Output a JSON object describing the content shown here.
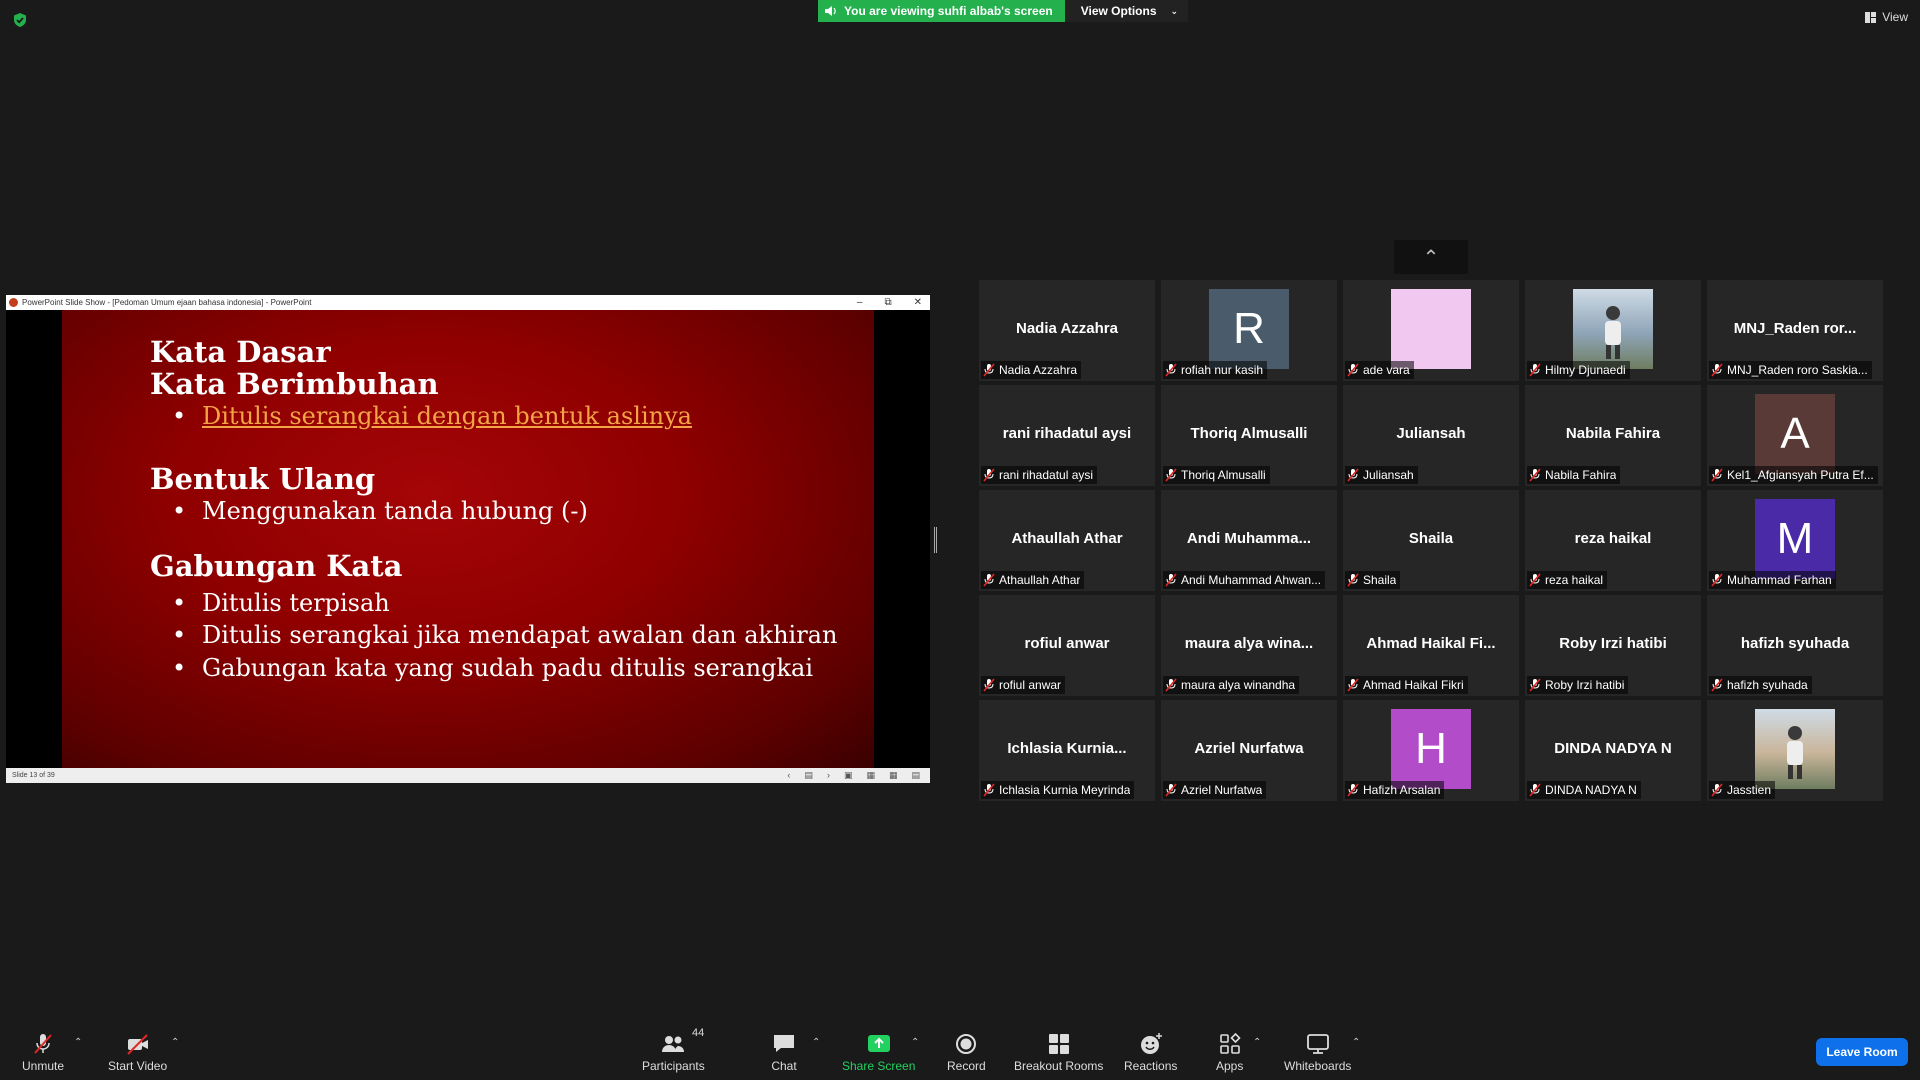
{
  "banner": {
    "text": "You are viewing suhfi albab's screen",
    "view_options": "View Options"
  },
  "view_label": "View",
  "powerpoint": {
    "title": "PowerPoint Slide Show - [Pedoman Umum ejaan bahasa indonesia] - PowerPoint",
    "status": "Slide 13 of 39",
    "slide": {
      "h1": "Kata Dasar",
      "h2": "Kata Berimbuhan",
      "b1": "Ditulis serangkai dengan bentuk aslinya",
      "h3": "Bentuk Ulang",
      "b2": "Menggunakan tanda hubung (-)",
      "h4": "Gabungan Kata",
      "b3": "Ditulis terpisah",
      "b4": "Ditulis serangkai jika mendapat awalan dan akhiran",
      "b5": "Gabungan kata yang sudah padu ditulis serangkai"
    }
  },
  "participants": [
    {
      "display": "Nadia Azzahra",
      "label": "Nadia Azzahra",
      "type": "name"
    },
    {
      "display": "R",
      "label": "rofiah nur kasih",
      "type": "letter",
      "color": "#4a5c6b"
    },
    {
      "display": "",
      "label": "ade vara",
      "type": "color",
      "color": "#f0c8f0"
    },
    {
      "display": "",
      "label": "Hilmy Djunaedi",
      "type": "photo",
      "color": "#8fa5b8"
    },
    {
      "display": "MNJ_Raden ror...",
      "label": "MNJ_Raden roro Saskia...",
      "type": "name"
    },
    {
      "display": "rani rihadatul aysi",
      "label": "rani rihadatul aysi",
      "type": "name"
    },
    {
      "display": "Thoriq Almusalli",
      "label": "Thoriq Almusalli",
      "type": "name"
    },
    {
      "display": "Juliansah",
      "label": "Juliansah",
      "type": "name"
    },
    {
      "display": "Nabila Fahira",
      "label": "Nabila Fahira",
      "type": "name"
    },
    {
      "display": "A",
      "label": "Kel1_Afgiansyah Putra Ef...",
      "type": "letter",
      "color": "#5a3a36"
    },
    {
      "display": "Athaullah Athar",
      "label": "Athaullah Athar",
      "type": "name"
    },
    {
      "display": "Andi  Muhamma...",
      "label": "Andi Muhammad Ahwan...",
      "type": "name"
    },
    {
      "display": "Shaila",
      "label": "Shaila",
      "type": "name"
    },
    {
      "display": "reza haikal",
      "label": "reza haikal",
      "type": "name"
    },
    {
      "display": "M",
      "label": "Muhammad Farhan",
      "type": "letter",
      "color": "#4b2aa8"
    },
    {
      "display": "rofiul anwar",
      "label": "rofiul anwar",
      "type": "name"
    },
    {
      "display": "maura  alya  wina...",
      "label": "maura alya winandha",
      "type": "name"
    },
    {
      "display": "Ahmad  Haikal  Fi...",
      "label": "Ahmad Haikal Fikri",
      "type": "name"
    },
    {
      "display": "Roby Irzi hatibi",
      "label": "Roby Irzi hatibi",
      "type": "name"
    },
    {
      "display": "hafizh syuhada",
      "label": "hafizh syuhada",
      "type": "name"
    },
    {
      "display": "Ichlasia  Kurnia...",
      "label": "Ichlasia Kurnia Meyrinda",
      "type": "name"
    },
    {
      "display": "Azriel Nurfatwa",
      "label": "Azriel Nurfatwa",
      "type": "name"
    },
    {
      "display": "H",
      "label": "Hafizh Arsalan",
      "type": "letter",
      "color": "#b24cc8"
    },
    {
      "display": "DINDA NADYA N",
      "label": "DINDA NADYA N",
      "type": "name"
    },
    {
      "display": "",
      "label": "Jasstien",
      "type": "photo",
      "color": "#c9b59a"
    }
  ],
  "toolbar": {
    "unmute": "Unmute",
    "start_video": "Start Video",
    "participants": "Participants",
    "participants_count": "44",
    "chat": "Chat",
    "share_screen": "Share Screen",
    "record": "Record",
    "breakout": "Breakout Rooms",
    "reactions": "Reactions",
    "apps": "Apps",
    "whiteboards": "Whiteboards",
    "leave": "Leave Room"
  },
  "colors": {
    "accent_green": "#23b04d",
    "leave_blue": "#0e71eb",
    "mute_red": "#e02828"
  }
}
